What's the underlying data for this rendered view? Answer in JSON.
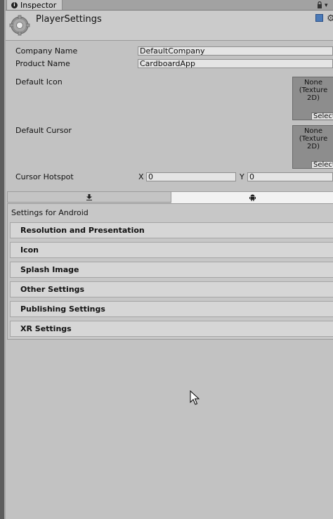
{
  "window": {
    "tab_label": "Inspector",
    "title": "PlayerSettings"
  },
  "properties": {
    "company_name_label": "Company Name",
    "company_name_value": "DefaultCompany",
    "product_name_label": "Product Name",
    "product_name_value": "CardboardApp",
    "default_icon_label": "Default Icon",
    "default_icon_slot": "None\n(Texture\n2D)",
    "default_icon_select": "Select",
    "default_cursor_label": "Default Cursor",
    "default_cursor_slot": "None\n(Texture\n2D)",
    "default_cursor_select": "Select",
    "cursor_hotspot_label": "Cursor Hotspot",
    "hotspot_x_label": "X",
    "hotspot_x_value": "0",
    "hotspot_y_label": "Y",
    "hotspot_y_value": "0"
  },
  "platform": {
    "settings_for": "Settings for Android",
    "tabs": [
      "standalone-download-icon",
      "android-icon"
    ],
    "sections": [
      "Resolution and Presentation",
      "Icon",
      "Splash Image",
      "Other Settings",
      "Publishing Settings",
      "XR Settings"
    ]
  },
  "colors": {
    "background": "#c2c2c2",
    "header": "#cbcbcb",
    "selected_tab": "#f2f2f2",
    "help_icon": "#4a7ab8"
  }
}
